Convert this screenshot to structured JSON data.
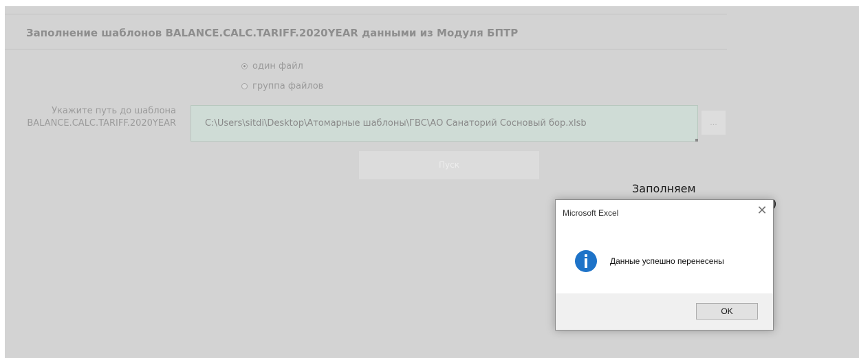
{
  "form": {
    "title": "Заполнение шаблонов BALANCE.CALC.TARIFF.2020YEAR данными из Модуля БПТР",
    "radio_single": "один файл",
    "radio_group": "группа файлов",
    "selected_mode": "один файл",
    "path_label_line1": "Укажите путь до шаблона",
    "path_label_line2": "BALANCE.CALC.TARIFF.2020YEAR",
    "path_value": "C:\\Users\\sitdi\\Desktop\\Атомарные шаблоны\\ГВС\\АО Санаторий Сосновый бор.xlsb",
    "browse_label": "...",
    "run_label": "Пуск",
    "status_text": "Заполняем"
  },
  "dialog": {
    "title": "Microsoft Excel",
    "close_glyph": "✕",
    "icon": "info-icon",
    "message": "Данные успешно перенесены",
    "ok_label": "OK"
  },
  "colors": {
    "form_bg": "#d3d3d3",
    "path_bg": "#cfdcd6",
    "info_blue": "#1e73c8"
  }
}
